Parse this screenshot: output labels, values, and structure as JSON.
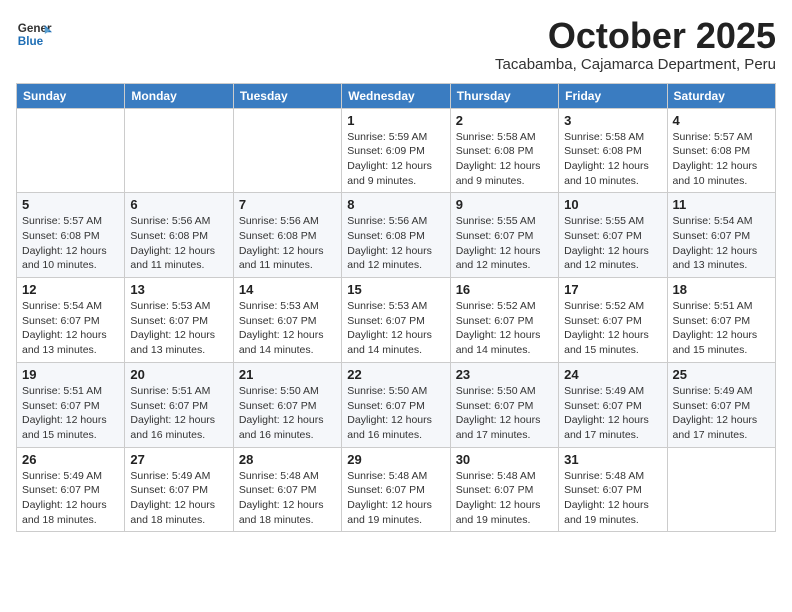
{
  "header": {
    "logo_general": "General",
    "logo_blue": "Blue",
    "month_title": "October 2025",
    "subtitle": "Tacabamba, Cajamarca Department, Peru"
  },
  "days_of_week": [
    "Sunday",
    "Monday",
    "Tuesday",
    "Wednesday",
    "Thursday",
    "Friday",
    "Saturday"
  ],
  "weeks": [
    [
      {
        "day": "",
        "info": ""
      },
      {
        "day": "",
        "info": ""
      },
      {
        "day": "",
        "info": ""
      },
      {
        "day": "1",
        "info": "Sunrise: 5:59 AM\nSunset: 6:09 PM\nDaylight: 12 hours and 9 minutes."
      },
      {
        "day": "2",
        "info": "Sunrise: 5:58 AM\nSunset: 6:08 PM\nDaylight: 12 hours and 9 minutes."
      },
      {
        "day": "3",
        "info": "Sunrise: 5:58 AM\nSunset: 6:08 PM\nDaylight: 12 hours and 10 minutes."
      },
      {
        "day": "4",
        "info": "Sunrise: 5:57 AM\nSunset: 6:08 PM\nDaylight: 12 hours and 10 minutes."
      }
    ],
    [
      {
        "day": "5",
        "info": "Sunrise: 5:57 AM\nSunset: 6:08 PM\nDaylight: 12 hours and 10 minutes."
      },
      {
        "day": "6",
        "info": "Sunrise: 5:56 AM\nSunset: 6:08 PM\nDaylight: 12 hours and 11 minutes."
      },
      {
        "day": "7",
        "info": "Sunrise: 5:56 AM\nSunset: 6:08 PM\nDaylight: 12 hours and 11 minutes."
      },
      {
        "day": "8",
        "info": "Sunrise: 5:56 AM\nSunset: 6:08 PM\nDaylight: 12 hours and 12 minutes."
      },
      {
        "day": "9",
        "info": "Sunrise: 5:55 AM\nSunset: 6:07 PM\nDaylight: 12 hours and 12 minutes."
      },
      {
        "day": "10",
        "info": "Sunrise: 5:55 AM\nSunset: 6:07 PM\nDaylight: 12 hours and 12 minutes."
      },
      {
        "day": "11",
        "info": "Sunrise: 5:54 AM\nSunset: 6:07 PM\nDaylight: 12 hours and 13 minutes."
      }
    ],
    [
      {
        "day": "12",
        "info": "Sunrise: 5:54 AM\nSunset: 6:07 PM\nDaylight: 12 hours and 13 minutes."
      },
      {
        "day": "13",
        "info": "Sunrise: 5:53 AM\nSunset: 6:07 PM\nDaylight: 12 hours and 13 minutes."
      },
      {
        "day": "14",
        "info": "Sunrise: 5:53 AM\nSunset: 6:07 PM\nDaylight: 12 hours and 14 minutes."
      },
      {
        "day": "15",
        "info": "Sunrise: 5:53 AM\nSunset: 6:07 PM\nDaylight: 12 hours and 14 minutes."
      },
      {
        "day": "16",
        "info": "Sunrise: 5:52 AM\nSunset: 6:07 PM\nDaylight: 12 hours and 14 minutes."
      },
      {
        "day": "17",
        "info": "Sunrise: 5:52 AM\nSunset: 6:07 PM\nDaylight: 12 hours and 15 minutes."
      },
      {
        "day": "18",
        "info": "Sunrise: 5:51 AM\nSunset: 6:07 PM\nDaylight: 12 hours and 15 minutes."
      }
    ],
    [
      {
        "day": "19",
        "info": "Sunrise: 5:51 AM\nSunset: 6:07 PM\nDaylight: 12 hours and 15 minutes."
      },
      {
        "day": "20",
        "info": "Sunrise: 5:51 AM\nSunset: 6:07 PM\nDaylight: 12 hours and 16 minutes."
      },
      {
        "day": "21",
        "info": "Sunrise: 5:50 AM\nSunset: 6:07 PM\nDaylight: 12 hours and 16 minutes."
      },
      {
        "day": "22",
        "info": "Sunrise: 5:50 AM\nSunset: 6:07 PM\nDaylight: 12 hours and 16 minutes."
      },
      {
        "day": "23",
        "info": "Sunrise: 5:50 AM\nSunset: 6:07 PM\nDaylight: 12 hours and 17 minutes."
      },
      {
        "day": "24",
        "info": "Sunrise: 5:49 AM\nSunset: 6:07 PM\nDaylight: 12 hours and 17 minutes."
      },
      {
        "day": "25",
        "info": "Sunrise: 5:49 AM\nSunset: 6:07 PM\nDaylight: 12 hours and 17 minutes."
      }
    ],
    [
      {
        "day": "26",
        "info": "Sunrise: 5:49 AM\nSunset: 6:07 PM\nDaylight: 12 hours and 18 minutes."
      },
      {
        "day": "27",
        "info": "Sunrise: 5:49 AM\nSunset: 6:07 PM\nDaylight: 12 hours and 18 minutes."
      },
      {
        "day": "28",
        "info": "Sunrise: 5:48 AM\nSunset: 6:07 PM\nDaylight: 12 hours and 18 minutes."
      },
      {
        "day": "29",
        "info": "Sunrise: 5:48 AM\nSunset: 6:07 PM\nDaylight: 12 hours and 19 minutes."
      },
      {
        "day": "30",
        "info": "Sunrise: 5:48 AM\nSunset: 6:07 PM\nDaylight: 12 hours and 19 minutes."
      },
      {
        "day": "31",
        "info": "Sunrise: 5:48 AM\nSunset: 6:07 PM\nDaylight: 12 hours and 19 minutes."
      },
      {
        "day": "",
        "info": ""
      }
    ]
  ]
}
